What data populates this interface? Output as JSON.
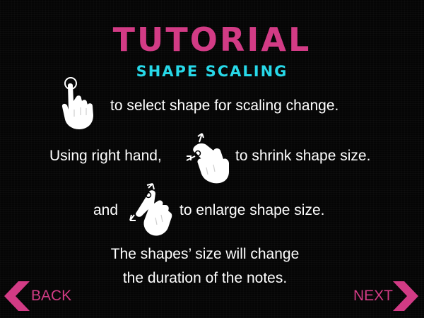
{
  "title": "TUTORIAL",
  "subtitle": "SHAPE SCALING",
  "instructions": {
    "tap_text": "to select shape for scaling change.",
    "pinch_prefix": "Using right hand,",
    "pinch_text": "to shrink shape size.",
    "spread_prefix": "and",
    "spread_text": "to enlarge shape size.",
    "note_line1": "The shapes’ size will change",
    "note_line2": "the duration of the notes."
  },
  "icons": {
    "tap": "tap-gesture-icon",
    "pinch": "pinch-in-gesture-icon",
    "spread": "pinch-out-gesture-icon",
    "back": "back-chevron-icon",
    "next": "next-chevron-icon"
  },
  "navigation": {
    "back_label": "BACK",
    "next_label": "NEXT"
  },
  "colors": {
    "accent_pink": "#d23b85",
    "accent_cyan": "#27d8e8",
    "background": "#050505",
    "text": "#ffffff"
  }
}
